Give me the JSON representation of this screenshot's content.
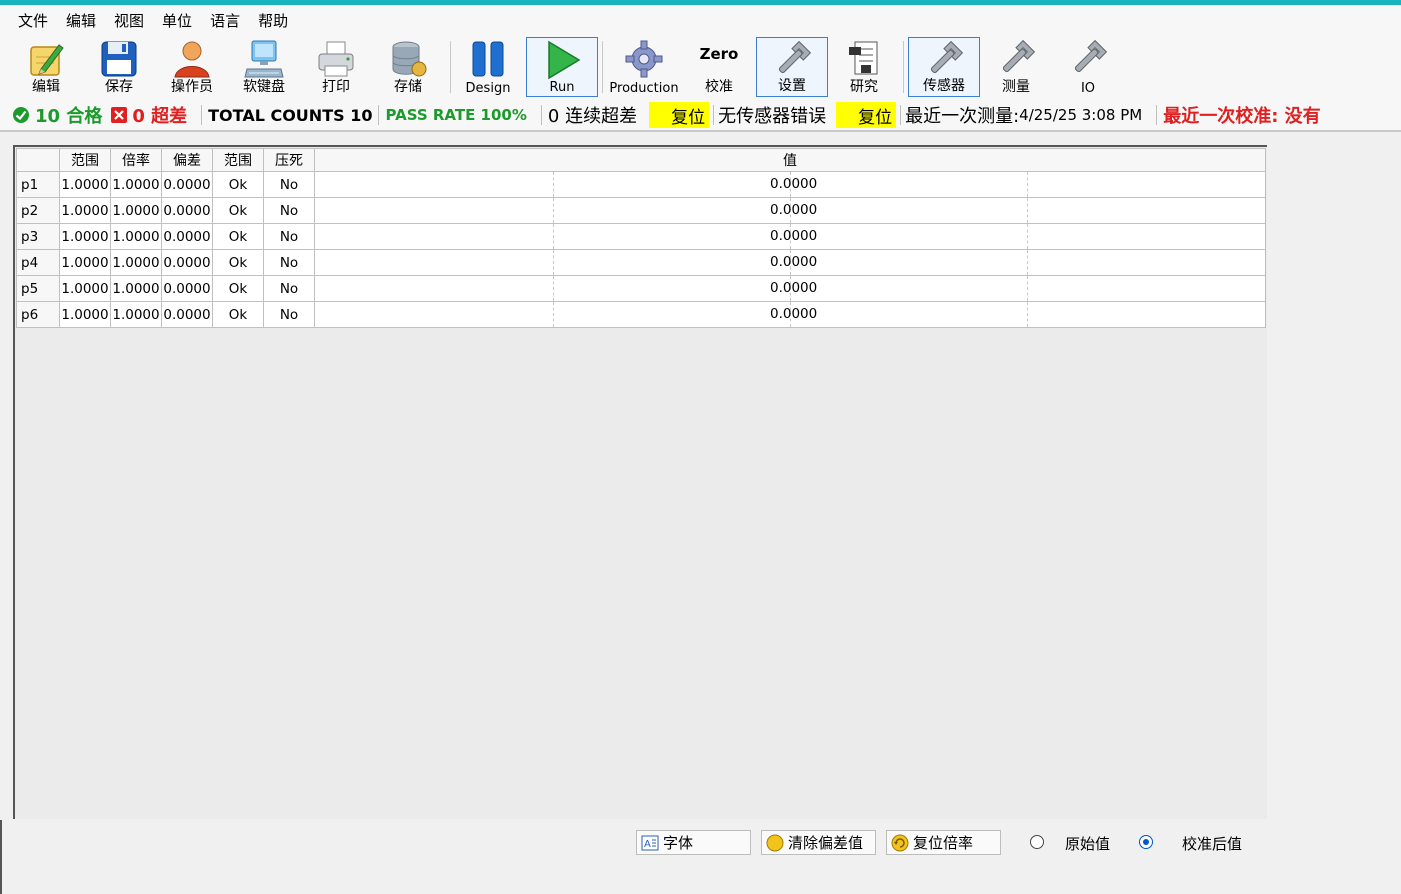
{
  "menu": [
    "文件",
    "编辑",
    "视图",
    "单位",
    "语言",
    "帮助"
  ],
  "toolbar": {
    "edit": "编辑",
    "save": "保存",
    "operator": "操作员",
    "keyboard": "软键盘",
    "print": "打印",
    "storage": "存储",
    "design": "Design",
    "run": "Run",
    "production": "Production",
    "zero_top": "Zero",
    "calibrate": "校准",
    "settings": "设置",
    "research": "研究",
    "sensor": "传感器",
    "measure": "测量",
    "io": "IO"
  },
  "status": {
    "pass_count": "10 合格",
    "fail_count": "0 超差",
    "total_counts": "TOTAL COUNTS 10",
    "pass_rate": "PASS RATE 100%",
    "consecutive_fail": "0 连续超差",
    "reset1": "复位",
    "sensor_error": "无传感器错误",
    "reset2": "复位",
    "last_measure_label": "最近一次测量:",
    "last_measure_value": " 4/25/25 3:08 PM",
    "last_calibration": "最近一次校准: 没有"
  },
  "grid": {
    "headers": [
      "范围",
      "倍率",
      "偏差",
      "范围",
      "压死",
      "值"
    ],
    "rows": [
      {
        "name": "p1",
        "c1": "1.0000",
        "c2": "1.0000",
        "c3": "0.0000",
        "c4": "Ok",
        "c5": "No",
        "value": "0.0000"
      },
      {
        "name": "p2",
        "c1": "1.0000",
        "c2": "1.0000",
        "c3": "0.0000",
        "c4": "Ok",
        "c5": "No",
        "value": "0.0000"
      },
      {
        "name": "p3",
        "c1": "1.0000",
        "c2": "1.0000",
        "c3": "0.0000",
        "c4": "Ok",
        "c5": "No",
        "value": "0.0000"
      },
      {
        "name": "p4",
        "c1": "1.0000",
        "c2": "1.0000",
        "c3": "0.0000",
        "c4": "Ok",
        "c5": "No",
        "value": "0.0000"
      },
      {
        "name": "p5",
        "c1": "1.0000",
        "c2": "1.0000",
        "c3": "0.0000",
        "c4": "Ok",
        "c5": "No",
        "value": "0.0000"
      },
      {
        "name": "p6",
        "c1": "1.0000",
        "c2": "1.0000",
        "c3": "0.0000",
        "c4": "Ok",
        "c5": "No",
        "value": "0.0000"
      }
    ]
  },
  "bottom": {
    "font_btn": "字体",
    "clear_offset_btn": "清除偏差值",
    "reset_ratio_btn": "复位倍率",
    "raw_label": "原始值",
    "calibrated_label": "校准后值",
    "selected": "calibrated"
  },
  "colors": {
    "accent": "#17b3c0",
    "pass": "#1c9a2c",
    "fail": "#e02020",
    "highlight": "#ffff00",
    "active_border": "#3c7fd1"
  },
  "icons": {
    "edit": "pencil-note-icon",
    "save": "floppy-disk-icon",
    "operator": "person-icon",
    "keyboard": "computer-keyboard-icon",
    "print": "printer-icon",
    "storage": "database-icon",
    "design": "pause-icon",
    "run": "play-icon",
    "production": "gear-icon",
    "settings": "wrench-icon",
    "research": "document-icon",
    "sensor": "wrench-icon",
    "measure": "wrench-icon",
    "io": "wrench-icon"
  }
}
